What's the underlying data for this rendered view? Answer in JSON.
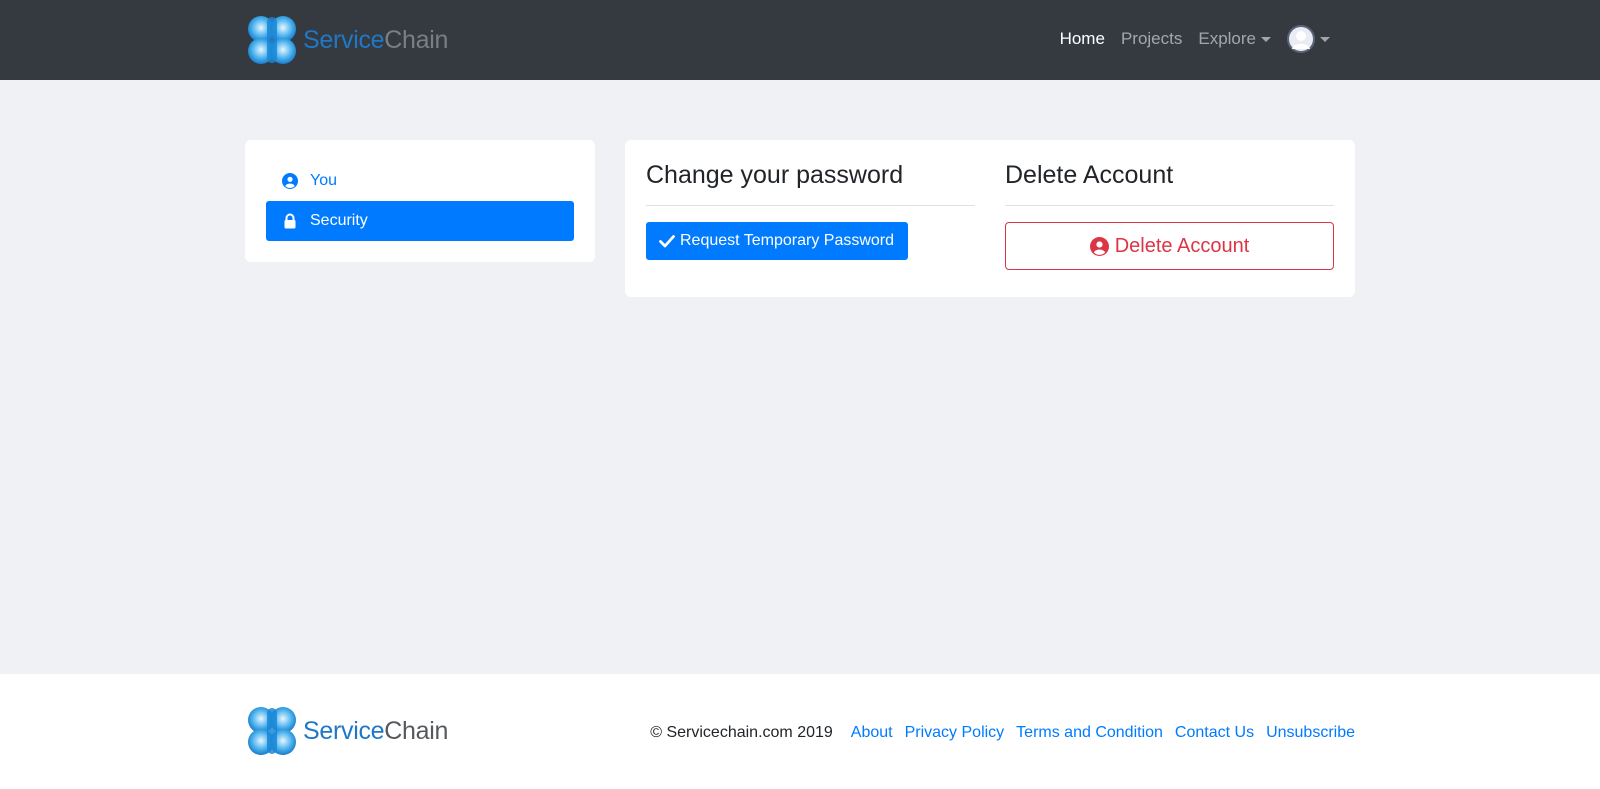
{
  "brand": {
    "name_part1": "Service",
    "name_part2": "Chain"
  },
  "nav": {
    "links": [
      {
        "label": "Home",
        "active": true
      },
      {
        "label": "Projects",
        "active": false
      },
      {
        "label": "Explore",
        "active": false,
        "dropdown": true
      }
    ],
    "avatar_icon": "user-avatar-icon"
  },
  "sidebar": {
    "items": [
      {
        "label": "You",
        "icon": "user-circle-icon",
        "active": false
      },
      {
        "label": "Security",
        "icon": "lock-icon",
        "active": true
      }
    ]
  },
  "password_section": {
    "title": "Change your password",
    "button_label": "Request Temporary Password",
    "button_icon": "check-icon"
  },
  "delete_section": {
    "title": "Delete Account",
    "button_label": "Delete Account",
    "button_icon": "user-circle-icon"
  },
  "footer": {
    "copyright": "© Servicechain.com 2019",
    "links": [
      "About",
      "Privacy Policy",
      "Terms and Condition",
      "Contact Us",
      "Unsubscribe"
    ]
  },
  "colors": {
    "navbar_bg": "#343a40",
    "page_bg": "#f0f1f5",
    "primary": "#007bff",
    "danger": "#dc3545"
  }
}
